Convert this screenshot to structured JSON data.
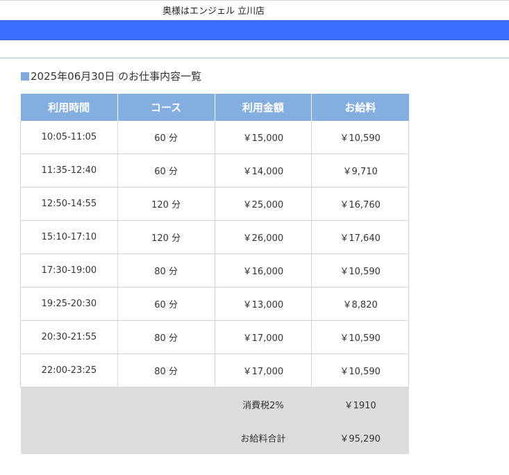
{
  "header": {
    "shop_name": "奥様はエンジェル 立川店"
  },
  "section": {
    "title": "2025年06月30日 のお仕事内容一覧"
  },
  "table": {
    "headers": [
      "利用時間",
      "コース",
      "利用金額",
      "お給料"
    ],
    "rows": [
      [
        "10:05-11:05",
        "60 分",
        "￥15,000",
        "￥10,590"
      ],
      [
        "11:35-12:40",
        "60 分",
        "￥14,000",
        "￥9,710"
      ],
      [
        "12:50-14:55",
        "120 分",
        "￥25,000",
        "￥16,760"
      ],
      [
        "15:10-17:10",
        "120 分",
        "￥26,000",
        "￥17,640"
      ],
      [
        "17:30-19:00",
        "80 分",
        "￥16,000",
        "￥10,590"
      ],
      [
        "19:25-20:30",
        "60 分",
        "￥13,000",
        "￥8,820"
      ],
      [
        "20:30-21:55",
        "80 分",
        "￥17,000",
        "￥10,590"
      ],
      [
        "22:00-23:25",
        "80 分",
        "￥17,000",
        "￥10,590"
      ]
    ]
  },
  "summary": {
    "tax_label": "消費税2%",
    "tax_value": "￥1910",
    "total_label": "お給料合計",
    "total_value": "￥95,290"
  },
  "colors": {
    "header_bar": "#3a6cff",
    "table_header": "#84aee0",
    "summary_bg": "#dcdcdc"
  }
}
